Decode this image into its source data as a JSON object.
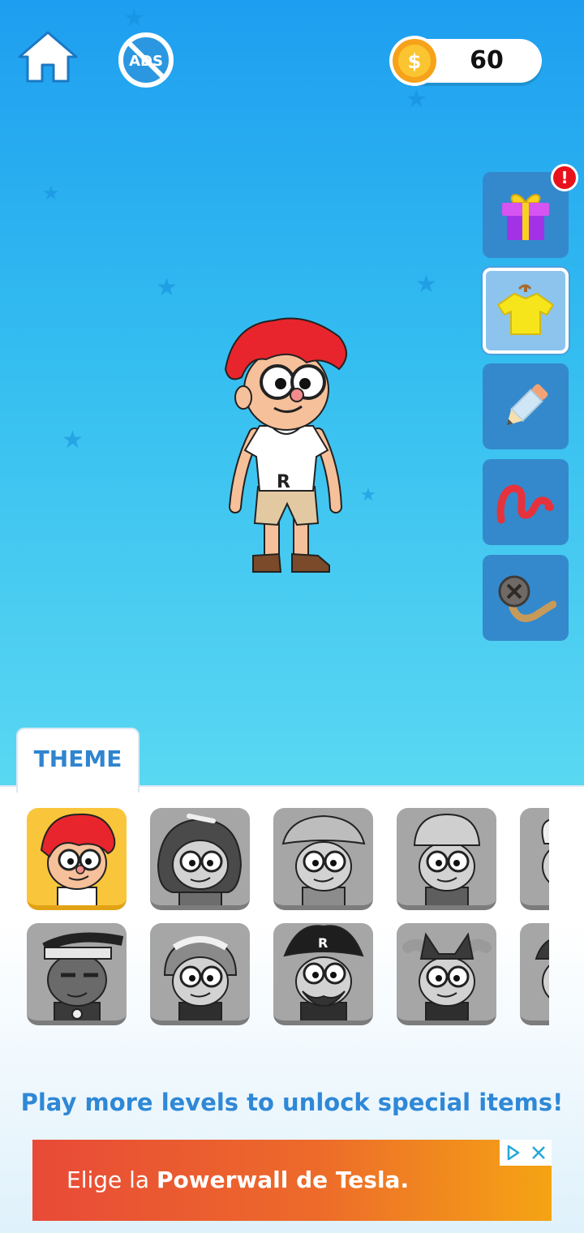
{
  "topbar": {
    "home_icon": "home-icon",
    "no_ads_icon": "no-ads-icon",
    "no_ads_label": "ADS",
    "coins": "60",
    "coin_symbol": "$"
  },
  "side_menu": [
    {
      "name": "gift",
      "icon": "gift-icon",
      "badge": "!"
    },
    {
      "name": "outfit",
      "icon": "shirt-icon",
      "selected": true
    },
    {
      "name": "pencil",
      "icon": "pencil-icon"
    },
    {
      "name": "line",
      "icon": "scribble-icon"
    },
    {
      "name": "rope",
      "icon": "rope-icon"
    }
  ],
  "character": {
    "shirt_letter": "R"
  },
  "theme_tab": {
    "label": "THEME"
  },
  "themes": [
    {
      "name": "red-hair-boy",
      "selected": true
    },
    {
      "name": "cave-girl",
      "locked": true
    },
    {
      "name": "explorer",
      "locked": true
    },
    {
      "name": "builder",
      "locked": true
    },
    {
      "name": "chef",
      "locked": true
    },
    {
      "name": "rapper",
      "locked": true
    },
    {
      "name": "maid",
      "locked": true
    },
    {
      "name": "pirate",
      "locked": true,
      "hat_letter": "R"
    },
    {
      "name": "cat-girl",
      "locked": true
    },
    {
      "name": "punk",
      "locked": true
    }
  ],
  "message": "Play more levels to unlock special items!",
  "ad": {
    "text_prefix": "Elige la ",
    "text_bold": "Powerwall de Tesla.",
    "adchoices_icon": "adchoices-icon",
    "close_icon": "close-icon"
  },
  "colors": {
    "sky_top": "#1e9ef0",
    "sky_bottom": "#5ad8f2",
    "side_button": "#3489cc",
    "accent_text": "#2f88d6",
    "selected_cell": "#f9c53b",
    "locked_cell": "#a6a6a6"
  }
}
